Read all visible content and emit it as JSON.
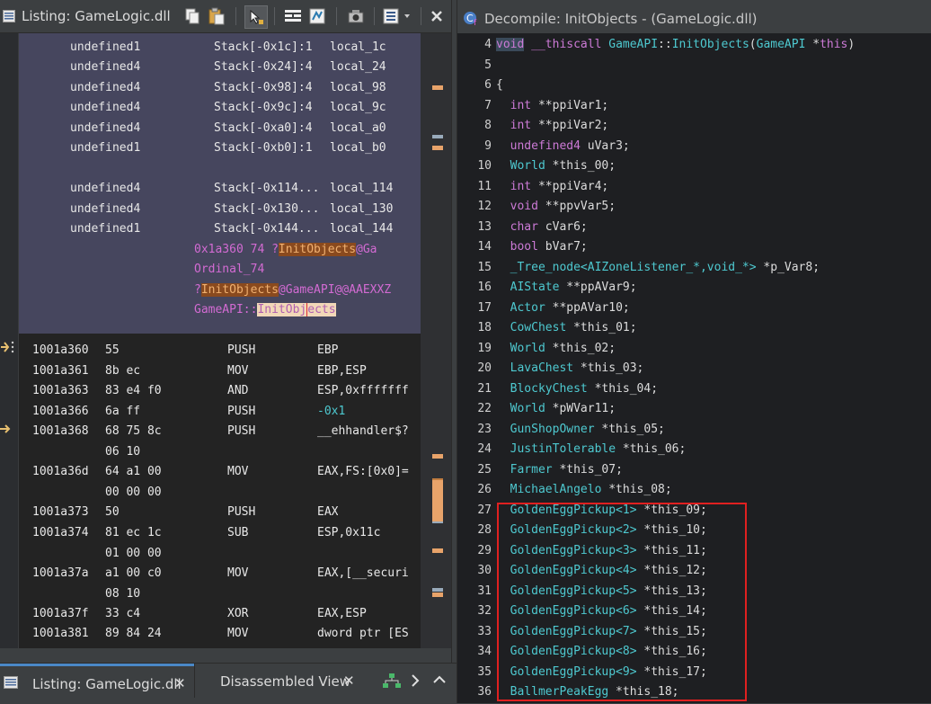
{
  "left_panel": {
    "title": "Listing:  GameLogic.dll",
    "variables": [
      {
        "type": "undefined1",
        "stack": "Stack[-0x1c]:1",
        "name": "local_1c"
      },
      {
        "type": "undefined4",
        "stack": "Stack[-0x24]:4",
        "name": "local_24"
      },
      {
        "type": "undefined4",
        "stack": "Stack[-0x98]:4",
        "name": "local_98"
      },
      {
        "type": "undefined4",
        "stack": "Stack[-0x9c]:4",
        "name": "local_9c"
      },
      {
        "type": "undefined4",
        "stack": "Stack[-0xa0]:4",
        "name": "local_a0"
      },
      {
        "type": "undefined1",
        "stack": "Stack[-0xb0]:1",
        "name": "local_b0"
      },
      {
        "type": "undefined4",
        "stack": "Stack[-0x114...",
        "name": "local_114"
      },
      {
        "type": "undefined4",
        "stack": "Stack[-0x130...",
        "name": "local_130"
      },
      {
        "type": "undefined1",
        "stack": "Stack[-0x144...",
        "name": "local_144"
      }
    ],
    "labels": {
      "export_line_prefix": "0x1a360  74  ?",
      "export_line_hl": "InitObjects",
      "export_line_suffix": "@Ga",
      "ordinal": "Ordinal_74",
      "mangled_prefix": "?",
      "mangled_hl": "InitObjects",
      "mangled_suffix": "@GameAPI@@AAEXXZ",
      "func_prefix": "GameAPI::",
      "func_hl1": "InitObj",
      "func_hl2": "ects"
    },
    "instructions": [
      {
        "addr": "1001a360",
        "bytes": "55",
        "mnem": "PUSH",
        "ops": "EBP"
      },
      {
        "addr": "1001a361",
        "bytes": "8b ec",
        "mnem": "MOV",
        "ops": "EBP,ESP"
      },
      {
        "addr": "1001a363",
        "bytes": "83 e4 f0",
        "mnem": "AND",
        "ops": "ESP,0xfffffff"
      },
      {
        "addr": "1001a366",
        "bytes": "6a ff",
        "mnem": "PUSH",
        "ops": "-0x1"
      },
      {
        "addr": "1001a368",
        "bytes": "68 75 8c",
        "bytes2": "06 10",
        "mnem": "PUSH",
        "ops": "__ehhandler$?"
      },
      {
        "addr": "1001a36d",
        "bytes": "64 a1 00",
        "bytes2": "00 00 00",
        "mnem": "MOV",
        "ops": "EAX,FS:[0x0]="
      },
      {
        "addr": "1001a373",
        "bytes": "50",
        "mnem": "PUSH",
        "ops": "EAX"
      },
      {
        "addr": "1001a374",
        "bytes": "81 ec 1c",
        "bytes2": "01 00 00",
        "mnem": "SUB",
        "ops": "ESP,0x11c"
      },
      {
        "addr": "1001a37a",
        "bytes": "a1 00 c0",
        "bytes2": "08 10",
        "mnem": "MOV",
        "ops": "EAX,[__securi"
      },
      {
        "addr": "1001a37f",
        "bytes": "33 c4",
        "mnem": "XOR",
        "ops": "EAX,ESP"
      },
      {
        "addr": "1001a381",
        "bytes": "89 84 24",
        "mnem": "MOV",
        "ops": "dword ptr [ES"
      }
    ]
  },
  "bottom_tabs": {
    "listing_label": "Listing:  GameLogic.dll",
    "disasm_label": "Disassembled View",
    "close_glyph": "✕"
  },
  "right_panel": {
    "title": "Decompile: InitObjects -  (GameLogic.dll)",
    "lines": [
      {
        "n": "4",
        "kind": "sig",
        "text": ""
      },
      {
        "n": "5",
        "kind": "blank",
        "text": ""
      },
      {
        "n": "6",
        "kind": "brace",
        "text": "{"
      },
      {
        "n": "7",
        "kind": "decl",
        "type": "int",
        "rest": " **ppiVar1;"
      },
      {
        "n": "8",
        "kind": "decl",
        "type": "int",
        "rest": " **ppiVar2;"
      },
      {
        "n": "9",
        "kind": "decl",
        "type": "undefined4",
        "rest": " uVar3;"
      },
      {
        "n": "10",
        "kind": "decl",
        "type": "World",
        "rest": " *this_00;"
      },
      {
        "n": "11",
        "kind": "decl",
        "type": "int",
        "rest": " **ppiVar4;"
      },
      {
        "n": "12",
        "kind": "decl",
        "type": "void",
        "rest": " **ppvVar5;"
      },
      {
        "n": "13",
        "kind": "decl",
        "type": "char",
        "rest": " cVar6;"
      },
      {
        "n": "14",
        "kind": "decl",
        "type": "bool",
        "rest": " bVar7;"
      },
      {
        "n": "15",
        "kind": "decl",
        "type": "_Tree_node<AIZoneListener_*,void_*>",
        "rest": " *p_Var8;"
      },
      {
        "n": "16",
        "kind": "decl",
        "type": "AIState",
        "rest": " **ppAVar9;"
      },
      {
        "n": "17",
        "kind": "decl",
        "type": "Actor",
        "rest": " **ppAVar10;"
      },
      {
        "n": "18",
        "kind": "decl",
        "type": "CowChest",
        "rest": " *this_01;"
      },
      {
        "n": "19",
        "kind": "decl",
        "type": "World",
        "rest": " *this_02;"
      },
      {
        "n": "20",
        "kind": "decl",
        "type": "LavaChest",
        "rest": " *this_03;"
      },
      {
        "n": "21",
        "kind": "decl",
        "type": "BlockyChest",
        "rest": " *this_04;"
      },
      {
        "n": "22",
        "kind": "decl",
        "type": "World",
        "rest": " *pWVar11;"
      },
      {
        "n": "23",
        "kind": "decl",
        "type": "GunShopOwner",
        "rest": " *this_05;"
      },
      {
        "n": "24",
        "kind": "decl",
        "type": "JustinTolerable",
        "rest": " *this_06;"
      },
      {
        "n": "25",
        "kind": "decl",
        "type": "Farmer",
        "rest": " *this_07;"
      },
      {
        "n": "26",
        "kind": "decl",
        "type": "MichaelAngelo",
        "rest": " *this_08;"
      },
      {
        "n": "27",
        "kind": "decl",
        "type": "GoldenEggPickup<1>",
        "rest": " *this_09;"
      },
      {
        "n": "28",
        "kind": "decl",
        "type": "GoldenEggPickup<2>",
        "rest": " *this_10;"
      },
      {
        "n": "29",
        "kind": "decl",
        "type": "GoldenEggPickup<3>",
        "rest": " *this_11;"
      },
      {
        "n": "30",
        "kind": "decl",
        "type": "GoldenEggPickup<4>",
        "rest": " *this_12;"
      },
      {
        "n": "31",
        "kind": "decl",
        "type": "GoldenEggPickup<5>",
        "rest": " *this_13;"
      },
      {
        "n": "32",
        "kind": "decl",
        "type": "GoldenEggPickup<6>",
        "rest": " *this_14;"
      },
      {
        "n": "33",
        "kind": "decl",
        "type": "GoldenEggPickup<7>",
        "rest": " *this_15;"
      },
      {
        "n": "34",
        "kind": "decl",
        "type": "GoldenEggPickup<8>",
        "rest": " *this_16;"
      },
      {
        "n": "35",
        "kind": "decl",
        "type": "GoldenEggPickup<9>",
        "rest": " *this_17;"
      },
      {
        "n": "36",
        "kind": "decl",
        "type": "BallmerPeakEgg",
        "rest": " *this_18;"
      }
    ],
    "signature": {
      "kw_void": "void",
      "kw_thiscall": "__thiscall",
      "class": "GameAPI",
      "sep": "::",
      "func": "InitObjects",
      "open": "(",
      "param_type": "GameAPI",
      "star": " *",
      "param_name": "this",
      "close": ")"
    }
  },
  "colors": {
    "keyword": "#cc7ad6",
    "type": "#4ec9d0",
    "highlight_box": "#e02020"
  }
}
